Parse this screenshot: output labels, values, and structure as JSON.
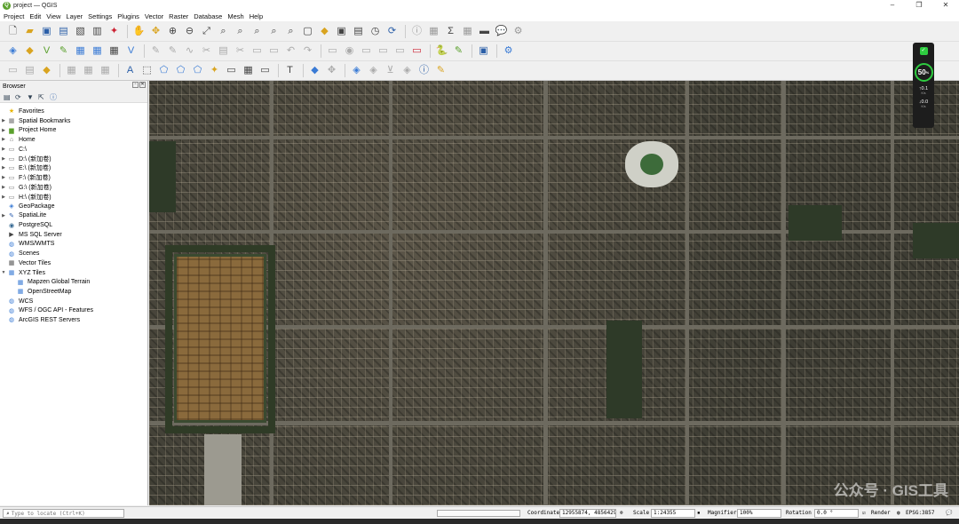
{
  "window": {
    "title": "project — QGIS",
    "app_icon": "Q"
  },
  "window_controls": [
    "–",
    "❐",
    "✕"
  ],
  "menu": [
    "Project",
    "Edit",
    "View",
    "Layer",
    "Settings",
    "Plugins",
    "Vector",
    "Raster",
    "Database",
    "Mesh",
    "Help"
  ],
  "browser": {
    "title": "Browser",
    "items": [
      {
        "label": "Favorites",
        "icon": "star-icon",
        "glyph": "★",
        "color": "#e8b400",
        "arrow": ""
      },
      {
        "label": "Spatial Bookmarks",
        "icon": "bookmark-icon",
        "glyph": "▦",
        "color": "#777",
        "arrow": "▶"
      },
      {
        "label": "Project Home",
        "icon": "folder-icon",
        "glyph": "▆",
        "color": "#5aa02c",
        "arrow": "▶"
      },
      {
        "label": "Home",
        "icon": "home-folder-icon",
        "glyph": "⌂",
        "color": "#666",
        "arrow": "▶"
      },
      {
        "label": "C:\\",
        "icon": "drive-icon",
        "glyph": "▭",
        "color": "#777",
        "arrow": "▶"
      },
      {
        "label": "D:\\ (新加卷)",
        "icon": "drive-icon",
        "glyph": "▭",
        "color": "#777",
        "arrow": "▶"
      },
      {
        "label": "E:\\ (新加卷)",
        "icon": "drive-icon",
        "glyph": "▭",
        "color": "#777",
        "arrow": "▶"
      },
      {
        "label": "F:\\ (新加卷)",
        "icon": "drive-icon",
        "glyph": "▭",
        "color": "#777",
        "arrow": "▶"
      },
      {
        "label": "G:\\ (新加卷)",
        "icon": "drive-icon",
        "glyph": "▭",
        "color": "#777",
        "arrow": "▶"
      },
      {
        "label": "H:\\ (新加卷)",
        "icon": "drive-icon",
        "glyph": "▭",
        "color": "#777",
        "arrow": "▶"
      },
      {
        "label": "GeoPackage",
        "icon": "geopackage-icon",
        "glyph": "◈",
        "color": "#3a7bd5",
        "arrow": ""
      },
      {
        "label": "SpatiaLite",
        "icon": "spatialite-icon",
        "glyph": "✎",
        "color": "#2a5db0",
        "arrow": "▶"
      },
      {
        "label": "PostgreSQL",
        "icon": "postgresql-icon",
        "glyph": "◉",
        "color": "#336791",
        "arrow": ""
      },
      {
        "label": "MS SQL Server",
        "icon": "mssql-icon",
        "glyph": "▶",
        "color": "#444",
        "arrow": ""
      },
      {
        "label": "WMS/WMTS",
        "icon": "globe-icon",
        "glyph": "◍",
        "color": "#3a7bd5",
        "arrow": ""
      },
      {
        "label": "Scenes",
        "icon": "scenes-icon",
        "glyph": "◍",
        "color": "#3a7bd5",
        "arrow": ""
      },
      {
        "label": "Vector Tiles",
        "icon": "vector-tiles-icon",
        "glyph": "▦",
        "color": "#555",
        "arrow": ""
      },
      {
        "label": "XYZ Tiles",
        "icon": "xyz-tiles-icon",
        "glyph": "▦",
        "color": "#3a7bd5",
        "arrow": "▼"
      },
      {
        "label": "Mapzen Global Terrain",
        "icon": "tile-layer-icon",
        "glyph": "▦",
        "color": "#3a7bd5",
        "arrow": "",
        "indent": true
      },
      {
        "label": "OpenStreetMap",
        "icon": "tile-layer-icon",
        "glyph": "▦",
        "color": "#3a7bd5",
        "arrow": "",
        "indent": true
      },
      {
        "label": "WCS",
        "icon": "globe-icon",
        "glyph": "◍",
        "color": "#3a7bd5",
        "arrow": ""
      },
      {
        "label": "WFS / OGC API - Features",
        "icon": "globe-icon",
        "glyph": "◍",
        "color": "#3a7bd5",
        "arrow": ""
      },
      {
        "label": "ArcGIS REST Servers",
        "icon": "arcgis-icon",
        "glyph": "◍",
        "color": "#3a7bd5",
        "arrow": ""
      }
    ]
  },
  "network_widget": {
    "speed": "50",
    "unit": "%",
    "up": "0.1",
    "down": "0.0",
    "rate_unit": "K/s"
  },
  "map": {
    "watermark": "公众号 · GIS工具"
  },
  "statusbar": {
    "locator_placeholder": "Type to locate (Ctrl+K)",
    "coordinate_label": "Coordinate",
    "coordinate_value": "12955874, 4856429",
    "scale_label": "Scale",
    "scale_value": "1:24355",
    "magnifier_label": "Magnifier",
    "magnifier_value": "100%",
    "rotation_label": "Rotation",
    "rotation_value": "0.0 °",
    "render_label": "Render",
    "crs_label": "EPSG:3857"
  }
}
